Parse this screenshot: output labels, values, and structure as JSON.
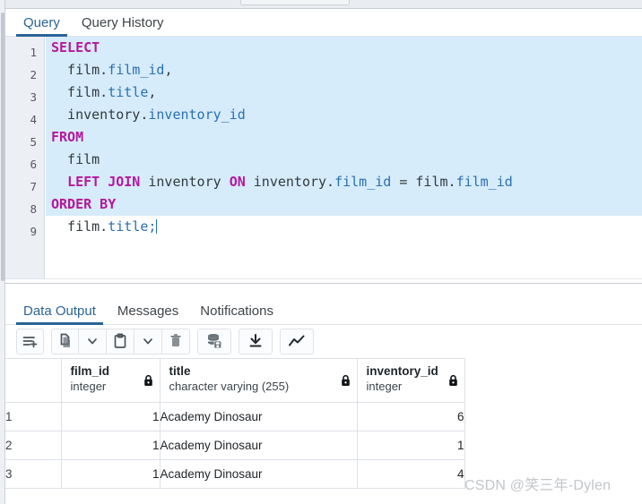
{
  "window": {
    "left_rail": "vertical-scroll-rail"
  },
  "query_tabs": {
    "items": [
      {
        "label": "Query",
        "active": true
      },
      {
        "label": "Query History",
        "active": false
      }
    ]
  },
  "editor": {
    "line_numbers": [
      "1",
      "2",
      "3",
      "4",
      "5",
      "6",
      "7",
      "8",
      "9"
    ],
    "lines": [
      {
        "n": "1",
        "selected": true,
        "tokens": [
          {
            "t": "SELECT",
            "c": "kw"
          }
        ]
      },
      {
        "n": "2",
        "selected": true,
        "tokens": [
          {
            "t": "  film.",
            "c": "pl"
          },
          {
            "t": "film_id",
            "c": "id"
          },
          {
            "t": ",",
            "c": "pl"
          }
        ]
      },
      {
        "n": "3",
        "selected": true,
        "tokens": [
          {
            "t": "  film.",
            "c": "pl"
          },
          {
            "t": "title",
            "c": "id"
          },
          {
            "t": ",",
            "c": "pl"
          }
        ]
      },
      {
        "n": "4",
        "selected": true,
        "tokens": [
          {
            "t": "  inventory.",
            "c": "pl"
          },
          {
            "t": "inventory_id",
            "c": "id"
          }
        ]
      },
      {
        "n": "5",
        "selected": true,
        "tokens": [
          {
            "t": "FROM",
            "c": "kw"
          }
        ]
      },
      {
        "n": "6",
        "selected": true,
        "tokens": [
          {
            "t": "  film",
            "c": "pl"
          }
        ]
      },
      {
        "n": "7",
        "selected": true,
        "tokens": [
          {
            "t": "  ",
            "c": "pl"
          },
          {
            "t": "LEFT JOIN",
            "c": "kw"
          },
          {
            "t": " inventory ",
            "c": "pl"
          },
          {
            "t": "ON",
            "c": "kw"
          },
          {
            "t": " inventory.",
            "c": "pl"
          },
          {
            "t": "film_id",
            "c": "id"
          },
          {
            "t": " = film.",
            "c": "pl"
          },
          {
            "t": "film_id",
            "c": "id"
          }
        ]
      },
      {
        "n": "8",
        "selected": true,
        "tokens": [
          {
            "t": "ORDER BY",
            "c": "kw"
          }
        ]
      },
      {
        "n": "9",
        "selected": false,
        "tokens": [
          {
            "t": "  film.",
            "c": "pl"
          },
          {
            "t": "title",
            "c": "id"
          },
          {
            "t": ";",
            "c": "id"
          }
        ]
      }
    ],
    "plain_text": "SELECT\n  film.film_id,\n  film.title,\n  inventory.inventory_id\nFROM\n  film\n  LEFT JOIN inventory ON inventory.film_id = film.film_id\nORDER BY\n  film.title;",
    "selection_color": "#d6ecfa",
    "keyword_color": "#b5179e",
    "identifier_color": "#2a6fb5"
  },
  "output_tabs": {
    "items": [
      {
        "label": "Data Output",
        "active": true
      },
      {
        "label": "Messages",
        "active": false
      },
      {
        "label": "Notifications",
        "active": false
      }
    ]
  },
  "toolbar": {
    "groups": [
      {
        "buttons": [
          {
            "icon": "add-row-icon",
            "label": "Add row"
          }
        ]
      },
      {
        "buttons": [
          {
            "icon": "copy-icon",
            "label": "Copy"
          },
          {
            "icon": "chevron-down-icon",
            "label": "Copy options"
          },
          {
            "icon": "paste-icon",
            "label": "Paste"
          },
          {
            "icon": "chevron-down-icon",
            "label": "Paste options"
          },
          {
            "icon": "trash-icon",
            "label": "Delete"
          }
        ]
      },
      {
        "buttons": [
          {
            "icon": "save-data-changes-icon",
            "label": "Save data changes"
          }
        ]
      },
      {
        "buttons": [
          {
            "icon": "download-icon",
            "label": "Download as CSV"
          }
        ]
      },
      {
        "buttons": [
          {
            "icon": "graph-visualiser-icon",
            "label": "Graph Visualiser"
          }
        ]
      }
    ]
  },
  "results": {
    "columns": [
      {
        "name": "",
        "type": "",
        "locked": false,
        "kind": "rownum"
      },
      {
        "name": "film_id",
        "type": "integer",
        "locked": true,
        "kind": "number"
      },
      {
        "name": "title",
        "type": "character varying (255)",
        "locked": true,
        "kind": "text"
      },
      {
        "name": "inventory_id",
        "type": "integer",
        "locked": true,
        "kind": "number"
      }
    ],
    "rows": [
      {
        "rownum": "1",
        "film_id": "1",
        "title": "Academy Dinosaur",
        "inventory_id": "6"
      },
      {
        "rownum": "2",
        "film_id": "1",
        "title": "Academy Dinosaur",
        "inventory_id": "1"
      },
      {
        "rownum": "3",
        "film_id": "1",
        "title": "Academy Dinosaur",
        "inventory_id": "4"
      }
    ]
  },
  "watermark": {
    "text": "CSDN @笑三年-Dylen"
  }
}
